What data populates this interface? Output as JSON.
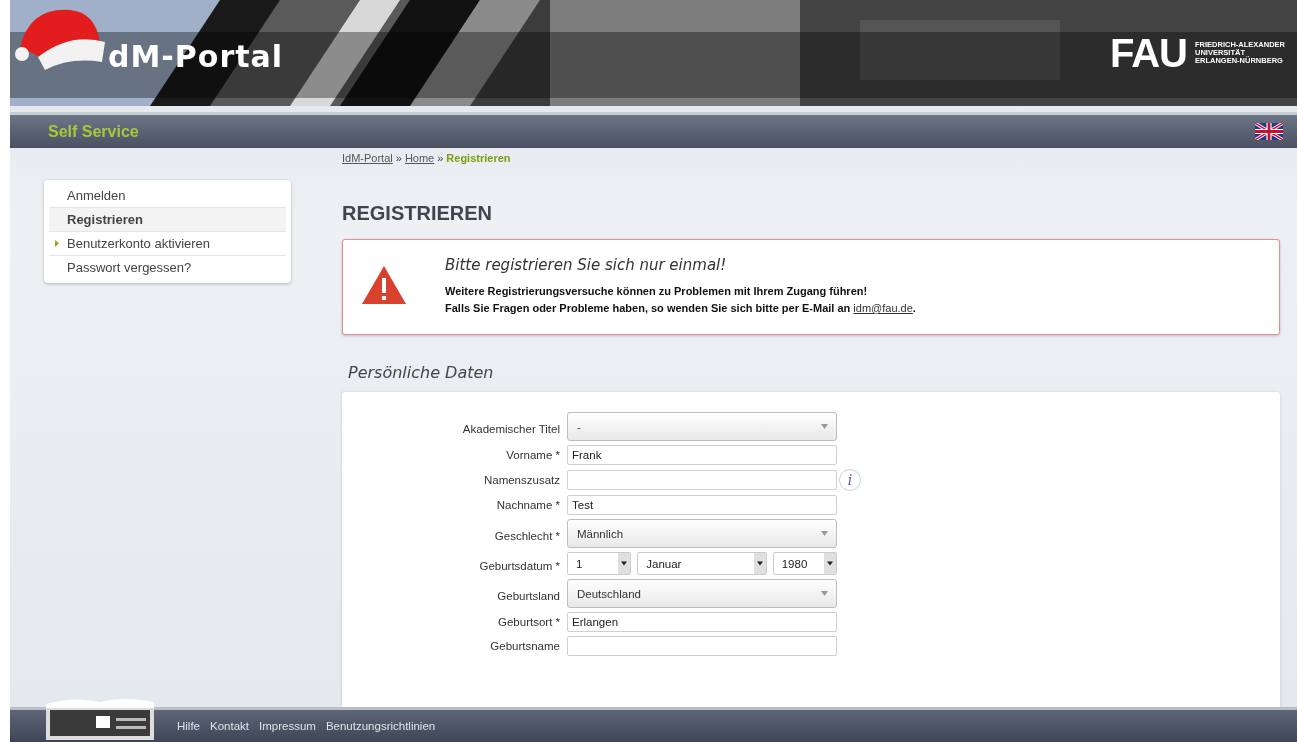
{
  "header": {
    "logo_text": "dM-Portal",
    "university": {
      "abbr": "FAU",
      "lines": [
        "FRIEDRICH-ALEXANDER",
        "UNIVERSITÄT",
        "ERLANGEN-NÜRNBERG"
      ]
    }
  },
  "nav": {
    "title": "Self Service"
  },
  "breadcrumb_separator": "»",
  "breadcrumb": [
    {
      "label": "IdM-Portal",
      "link": true
    },
    {
      "label": "Home",
      "link": true
    },
    {
      "label": "Registrieren",
      "link": false
    }
  ],
  "sidebar": {
    "items": [
      {
        "label": "Anmelden",
        "selected": false,
        "bullet": false
      },
      {
        "label": "Registrieren",
        "selected": true,
        "bullet": false
      },
      {
        "label": "Benutzerkonto aktivieren",
        "selected": false,
        "bullet": true
      },
      {
        "label": "Passwort vergessen?",
        "selected": false,
        "bullet": false
      }
    ]
  },
  "heading": "REGISTRIEREN",
  "alert": {
    "title": "Bitte registrieren Sie sich nur einmal!",
    "line_1": "Weitere Registrierungsversuche können zu Problemen mit Ihrem Zugang führen!",
    "line_2": "Falls Sie Fragen oder Probleme haben, so wenden Sie sich bitte per E-Mail an",
    "link": "idm@fau.de",
    "line_2_end": "."
  },
  "section_title": "Persönliche Daten",
  "fields": [
    {
      "kind": "select",
      "label": "Akademischer Titel",
      "value": "-"
    },
    {
      "kind": "text",
      "label": "Vorname *",
      "value": "Frank"
    },
    {
      "kind": "text",
      "label": "Namenszusatz",
      "info": "i"
    },
    {
      "kind": "text",
      "label": "Nachname *",
      "value": "Test"
    },
    {
      "kind": "select",
      "label": "Geschlecht *",
      "value": "Männlich"
    },
    {
      "kind": "date",
      "label": "Geburtsdatum *",
      "day": "1",
      "month": "Januar",
      "year": "1980"
    },
    {
      "kind": "select",
      "label": "Geburtsland",
      "value": "Deutschland"
    },
    {
      "kind": "text",
      "label": "Geburtsort *",
      "value": "Erlangen"
    },
    {
      "kind": "text",
      "label": "Geburtsname"
    }
  ],
  "footer": {
    "links": [
      "Hilfe",
      "Kontakt",
      "Impressum",
      "Benutzungsrichtlinien"
    ]
  }
}
